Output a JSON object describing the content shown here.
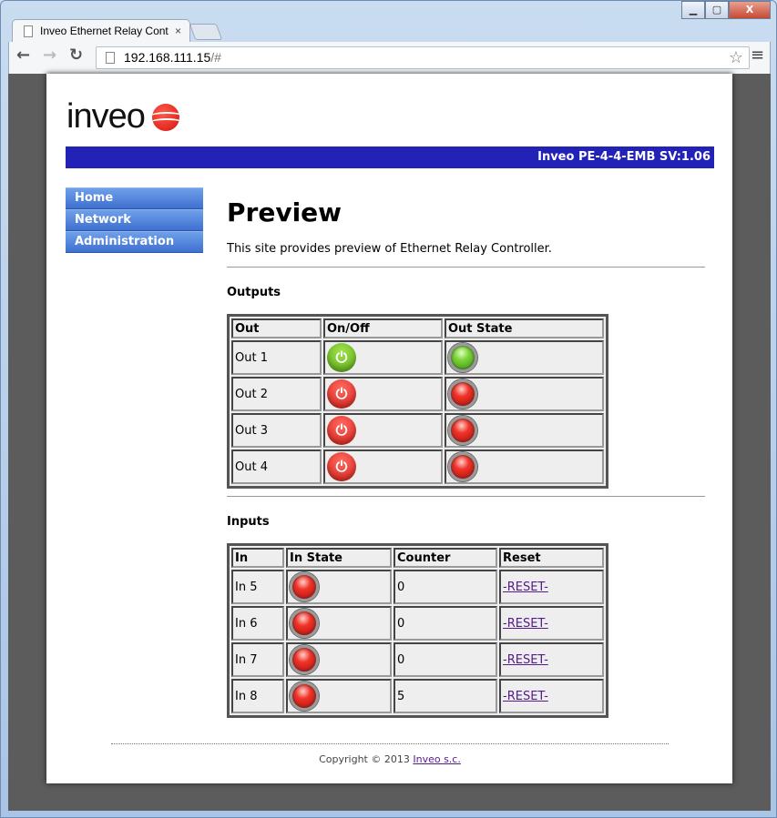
{
  "browser": {
    "tab_title": "Inveo Ethernet Relay Cont",
    "url_host": "192.168.111.15",
    "url_path": "/#"
  },
  "header": {
    "logo_text": "inveo",
    "banner": "Inveo PE-4-4-EMB SV:1.06"
  },
  "sidebar": {
    "items": [
      {
        "label": "Home"
      },
      {
        "label": "Network"
      },
      {
        "label": "Administration"
      }
    ]
  },
  "main": {
    "title": "Preview",
    "description": "This site provides preview of Ethernet Relay Controller.",
    "outputs": {
      "heading": "Outputs",
      "columns": [
        "Out",
        "On/Off",
        "Out State"
      ],
      "rows": [
        {
          "name": "Out 1",
          "on": true
        },
        {
          "name": "Out 2",
          "on": false
        },
        {
          "name": "Out 3",
          "on": false
        },
        {
          "name": "Out 4",
          "on": false
        }
      ]
    },
    "inputs": {
      "heading": "Inputs",
      "columns": [
        "In",
        "In State",
        "Counter",
        "Reset"
      ],
      "rows": [
        {
          "name": "In 5",
          "on": false,
          "counter": "0",
          "reset": "-RESET-"
        },
        {
          "name": "In 6",
          "on": false,
          "counter": "0",
          "reset": "-RESET-"
        },
        {
          "name": "In 7",
          "on": false,
          "counter": "0",
          "reset": "-RESET-"
        },
        {
          "name": "In 8",
          "on": false,
          "counter": "5",
          "reset": "-RESET-"
        }
      ]
    }
  },
  "footer": {
    "copyright": "Copyright © 2013 ",
    "link": "Inveo s.c."
  },
  "colors": {
    "banner": "#2222b6",
    "on": "#5aa81a",
    "off": "#d6201a"
  }
}
